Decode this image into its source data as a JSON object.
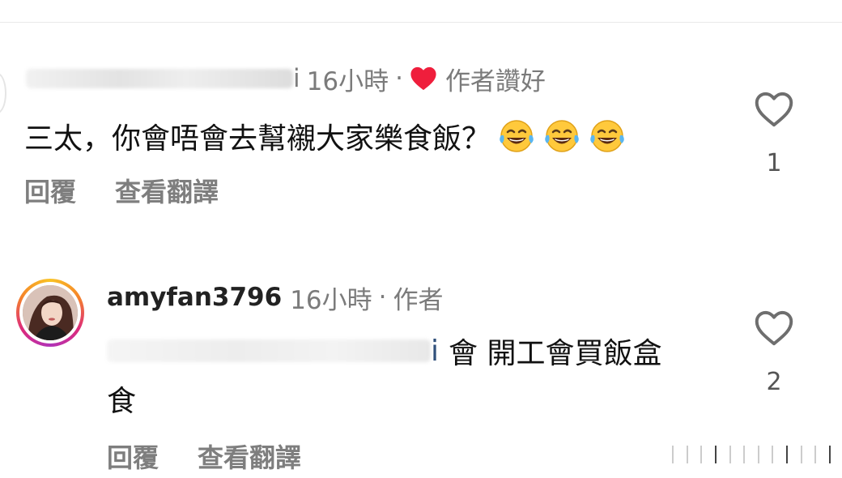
{
  "comments": [
    {
      "username_suffix": "i",
      "time": "16小時",
      "separator": "·",
      "badge": "作者讚好",
      "text": "三太，你會唔會去幫襯大家樂食飯？",
      "emoji_count": 3,
      "actions": {
        "reply": "回覆",
        "translate": "查看翻譯"
      },
      "likes": "1"
    },
    {
      "username": "amyfan3796",
      "time": "16小時",
      "separator": "·",
      "badge": "作者",
      "mention_suffix": "i",
      "text_line1": "會 開工會買飯盒",
      "text_line2": "食",
      "actions": {
        "reply": "回覆",
        "translate": "查看翻譯"
      },
      "likes": "2"
    }
  ],
  "colors": {
    "heart_red": "#ef1e3c",
    "meta_gray": "#7b7b7b",
    "action_gray": "#7e7e7e",
    "mention_blue": "#2f4f7a"
  },
  "icons": {
    "like": "heart-outline-icon",
    "author_liked": "heart-filled-icon",
    "emoji": "face-with-tears-of-joy-icon"
  }
}
